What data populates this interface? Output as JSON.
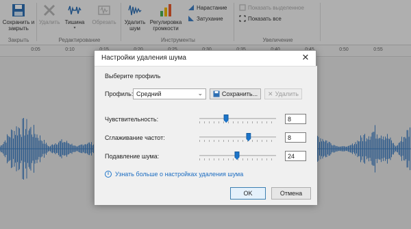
{
  "ribbon": {
    "groups": {
      "close": "Закрыть",
      "edit": "Редактирование",
      "tools": "Инструменты",
      "zoom": "Увеличение"
    },
    "buttons": {
      "save_close": "Сохранить и закрыть",
      "delete": "Удалить",
      "silence": "Тишина",
      "trim": "Обрезать",
      "remove_noise": "Удалить шум",
      "volume": "Регулировка громкости",
      "fade_in": "Нарастание",
      "fade_out": "Затухание",
      "zoom_selection": "Показать выделенное",
      "zoom_all": "Показать все"
    }
  },
  "timeline": {
    "labels": [
      "0:05",
      "0:10",
      "0:15",
      "0:20",
      "0:25",
      "0:30",
      "0:35",
      "0:40",
      "0:45",
      "0:50",
      "0:55"
    ]
  },
  "dialog": {
    "title": "Настройки удаления шума",
    "choose_profile": "Выберите профиль",
    "profile_label": "Профиль:",
    "profile_value": "Средний",
    "save_button": "Сохранить...",
    "delete_button": "Удалить",
    "sliders": [
      {
        "label": "Чувствительность:",
        "value": "8",
        "fraction": 0.35
      },
      {
        "label": "Сглаживание частот:",
        "value": "8",
        "fraction": 0.64
      },
      {
        "label": "Подавление шума:",
        "value": "24",
        "fraction": 0.49
      }
    ],
    "info_link": "Узнать больше о настройках удаления шума",
    "ok": "OK",
    "cancel": "Отмена"
  },
  "colors": {
    "accent": "#1c74c9",
    "wave": "#3f7fc3"
  }
}
